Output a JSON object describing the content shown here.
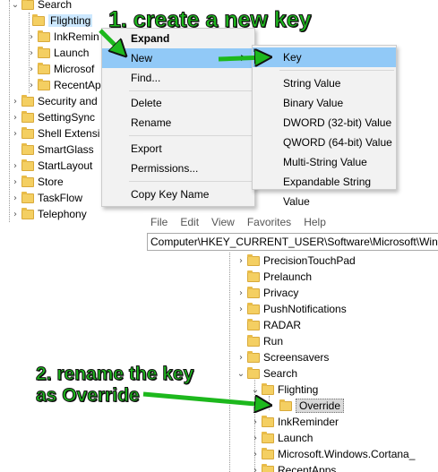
{
  "top_tree": {
    "items": [
      {
        "label": "Search",
        "expanded": true
      },
      {
        "label": "Flighting",
        "selected": true
      },
      {
        "label": "InkRemin"
      },
      {
        "label": "Launch"
      },
      {
        "label": "Microsof"
      },
      {
        "label": "RecentAp"
      },
      {
        "label": "Security and"
      },
      {
        "label": "SettingSync"
      },
      {
        "label": "Shell Extensi"
      },
      {
        "label": "SmartGlass"
      },
      {
        "label": "StartLayout"
      },
      {
        "label": "Store"
      },
      {
        "label": "TaskFlow"
      },
      {
        "label": "Telephony"
      }
    ]
  },
  "context_menu": {
    "expand": "Expand",
    "new": "New",
    "find": "Find...",
    "delete": "Delete",
    "rename": "Rename",
    "export": "Export",
    "permissions": "Permissions...",
    "copy_key_name": "Copy Key Name"
  },
  "submenu": {
    "key": "Key",
    "string_value": "String Value",
    "binary_value": "Binary Value",
    "dword_value": "DWORD (32-bit) Value",
    "qword_value": "QWORD (64-bit) Value",
    "multi_string_value": "Multi-String Value",
    "expandable_string_value": "Expandable String Value"
  },
  "menubar": {
    "file": "File",
    "edit": "Edit",
    "view": "View",
    "favorites": "Favorites",
    "help": "Help"
  },
  "address_bar": {
    "path": "Computer\\HKEY_CURRENT_USER\\Software\\Microsoft\\Windo"
  },
  "bottom_tree": {
    "items": [
      {
        "label": "PrecisionTouchPad"
      },
      {
        "label": "Prelaunch"
      },
      {
        "label": "Privacy"
      },
      {
        "label": "PushNotifications"
      },
      {
        "label": "RADAR"
      },
      {
        "label": "Run"
      },
      {
        "label": "Screensavers"
      },
      {
        "label": "Search",
        "expanded": true
      },
      {
        "label": "Flighting",
        "expanded": true
      },
      {
        "label": "Override",
        "selected": true
      },
      {
        "label": "InkReminder"
      },
      {
        "label": "Launch"
      },
      {
        "label": "Microsoft.Windows.Cortana_"
      },
      {
        "label": "RecentApps"
      }
    ]
  },
  "annotations": {
    "step1": "1. create a new key",
    "step2_line1": "2. rename the key",
    "step2_line2": "as Override"
  },
  "colors": {
    "menu_highlight": "#91c9f7",
    "folder": "#f4cf62",
    "callout_green": "#1db81d"
  }
}
